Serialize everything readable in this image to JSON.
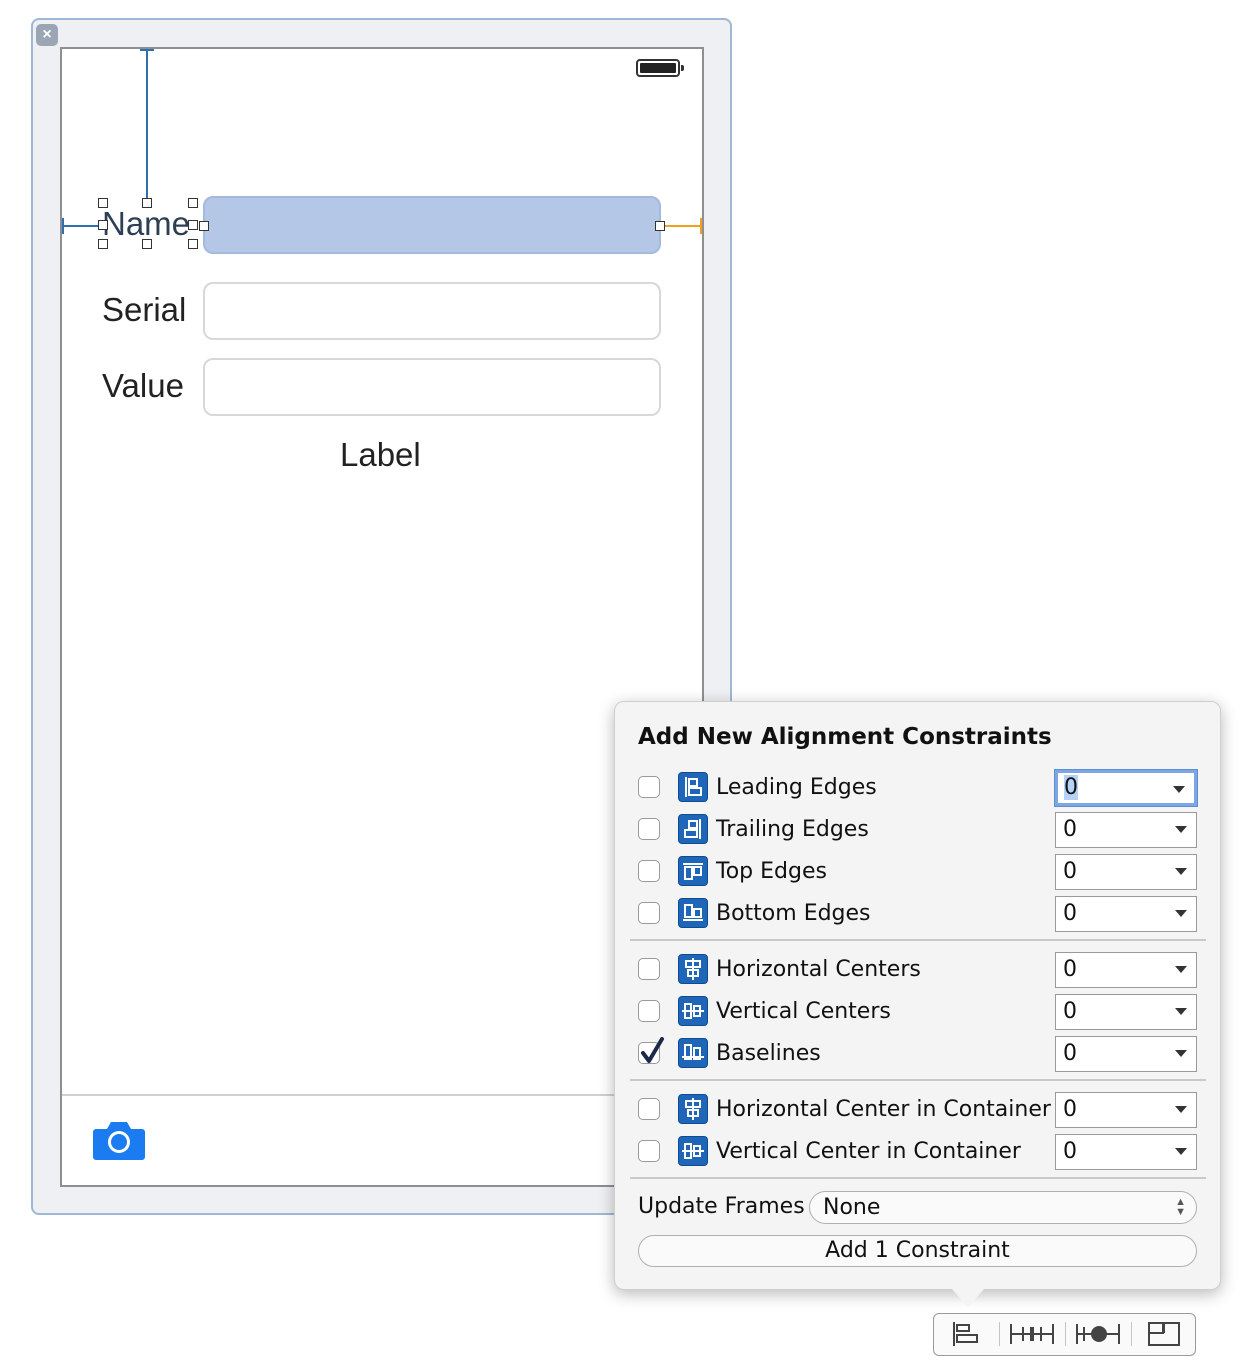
{
  "scene": {
    "close_glyph": "×",
    "labels": {
      "name": "Name",
      "serial": "Serial",
      "value": "Value",
      "center": "Label"
    },
    "icons": [
      "battery-icon",
      "camera-icon"
    ],
    "colors": {
      "selection": "#b4c7e7",
      "guide": "#2f6fb0",
      "guide_conflict": "#f0a020",
      "camera": "#1a7cf0"
    }
  },
  "popover": {
    "title": "Add New Alignment Constraints",
    "rows": [
      {
        "label": "Leading Edges",
        "checked": false,
        "value": "0",
        "icon": "leading-edges-icon"
      },
      {
        "label": "Trailing Edges",
        "checked": false,
        "value": "0",
        "icon": "trailing-edges-icon"
      },
      {
        "label": "Top Edges",
        "checked": false,
        "value": "0",
        "icon": "top-edges-icon"
      },
      {
        "label": "Bottom Edges",
        "checked": false,
        "value": "0",
        "icon": "bottom-edges-icon"
      },
      {
        "label": "Horizontal Centers",
        "checked": false,
        "value": "0",
        "icon": "horizontal-centers-icon"
      },
      {
        "label": "Vertical Centers",
        "checked": false,
        "value": "0",
        "icon": "vertical-centers-icon"
      },
      {
        "label": "Baselines",
        "checked": true,
        "value": "0",
        "icon": "baselines-icon"
      },
      {
        "label": "Horizontal Center in Container",
        "checked": false,
        "value": "0",
        "icon": "horizontal-center-container-icon"
      },
      {
        "label": "Vertical Center in Container",
        "checked": false,
        "value": "0",
        "icon": "vertical-center-container-icon"
      }
    ],
    "update_frames": {
      "label": "Update Frames",
      "value": "None"
    },
    "add_button": "Add 1 Constraint"
  },
  "toolbar": {
    "buttons": [
      "align-icon",
      "pin-icon",
      "resolve-issues-icon",
      "resizing-behavior-icon"
    ]
  }
}
